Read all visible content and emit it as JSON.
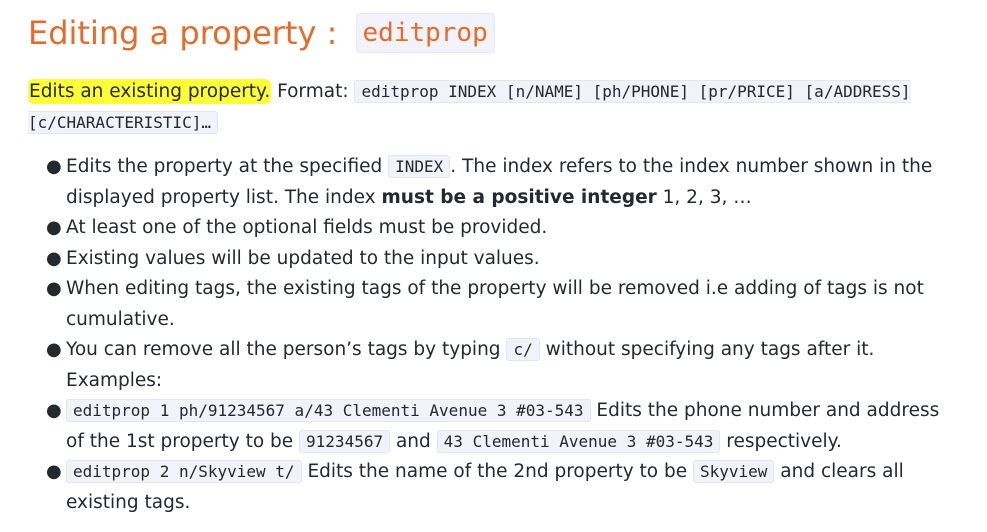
{
  "heading": {
    "title": "Editing a property : ",
    "command": "editprop"
  },
  "intro": {
    "highlighted": "Edits an existing property.",
    "format_label": " Format: ",
    "format_code": "editprop INDEX [n/NAME] [ph/PHONE] [pr/PRICE] [a/ADDRESS] [c/CHARACTERISTIC]…"
  },
  "bullets": {
    "b1": {
      "t1": "Edits the property at the specified ",
      "code1": "INDEX",
      "t2": ". The index refers to the index number shown in the displayed property list. The index ",
      "bold": "must be a positive integer",
      "t3": " 1, 2, 3, …"
    },
    "b2": {
      "t1": "At least one of the optional fields must be provided."
    },
    "b3": {
      "t1": "Existing values will be updated to the input values."
    },
    "b4": {
      "t1": "When editing tags, the existing tags of the property will be removed i.e adding of tags is not cumulative."
    },
    "b5": {
      "t1": "You can remove all the person’s tags by typing ",
      "code1": "c/",
      "t2": " without specifying any tags after it. Examples:"
    },
    "b6": {
      "code1": "editprop 1 ph/91234567 a/43 Clementi Avenue 3 #03-543",
      "t1": " Edits the phone number and address of the 1st property to be ",
      "code2": "91234567",
      "t2": " and ",
      "code3": "43 Clementi Avenue 3 #03-543",
      "t3": " respectively."
    },
    "b7": {
      "code1": "editprop 2 n/Skyview t/",
      "t1": " Edits the name of the 2nd property to be ",
      "code2": "Skyview",
      "t2": " and clears all existing tags."
    }
  },
  "bullet_glyph": "●"
}
